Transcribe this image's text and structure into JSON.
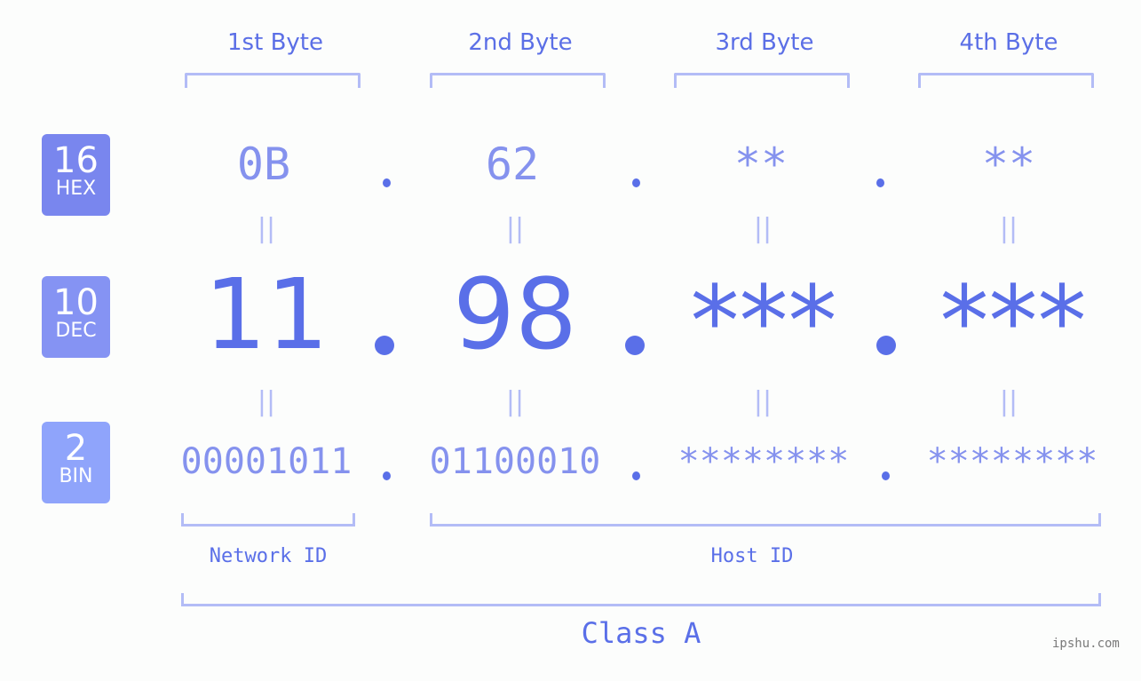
{
  "bytes": {
    "headers": [
      "1st Byte",
      "2nd Byte",
      "3rd Byte",
      "4th Byte"
    ]
  },
  "rows": {
    "hex": {
      "base": "16",
      "label": "HEX",
      "values": [
        "0B",
        "62",
        "**",
        "**"
      ],
      "color": "#7986ee"
    },
    "dec": {
      "base": "10",
      "label": "DEC",
      "values": [
        "11",
        "98",
        "***",
        "***"
      ],
      "color": "#8593f3"
    },
    "bin": {
      "base": "2",
      "label": "BIN",
      "values": [
        "00001011",
        "01100010",
        "********",
        "********"
      ],
      "color": "#8fa4fb"
    }
  },
  "separator": "=",
  "segments": {
    "network": "Network ID",
    "host": "Host ID",
    "class": "Class A"
  },
  "watermark": "ipshu.com"
}
